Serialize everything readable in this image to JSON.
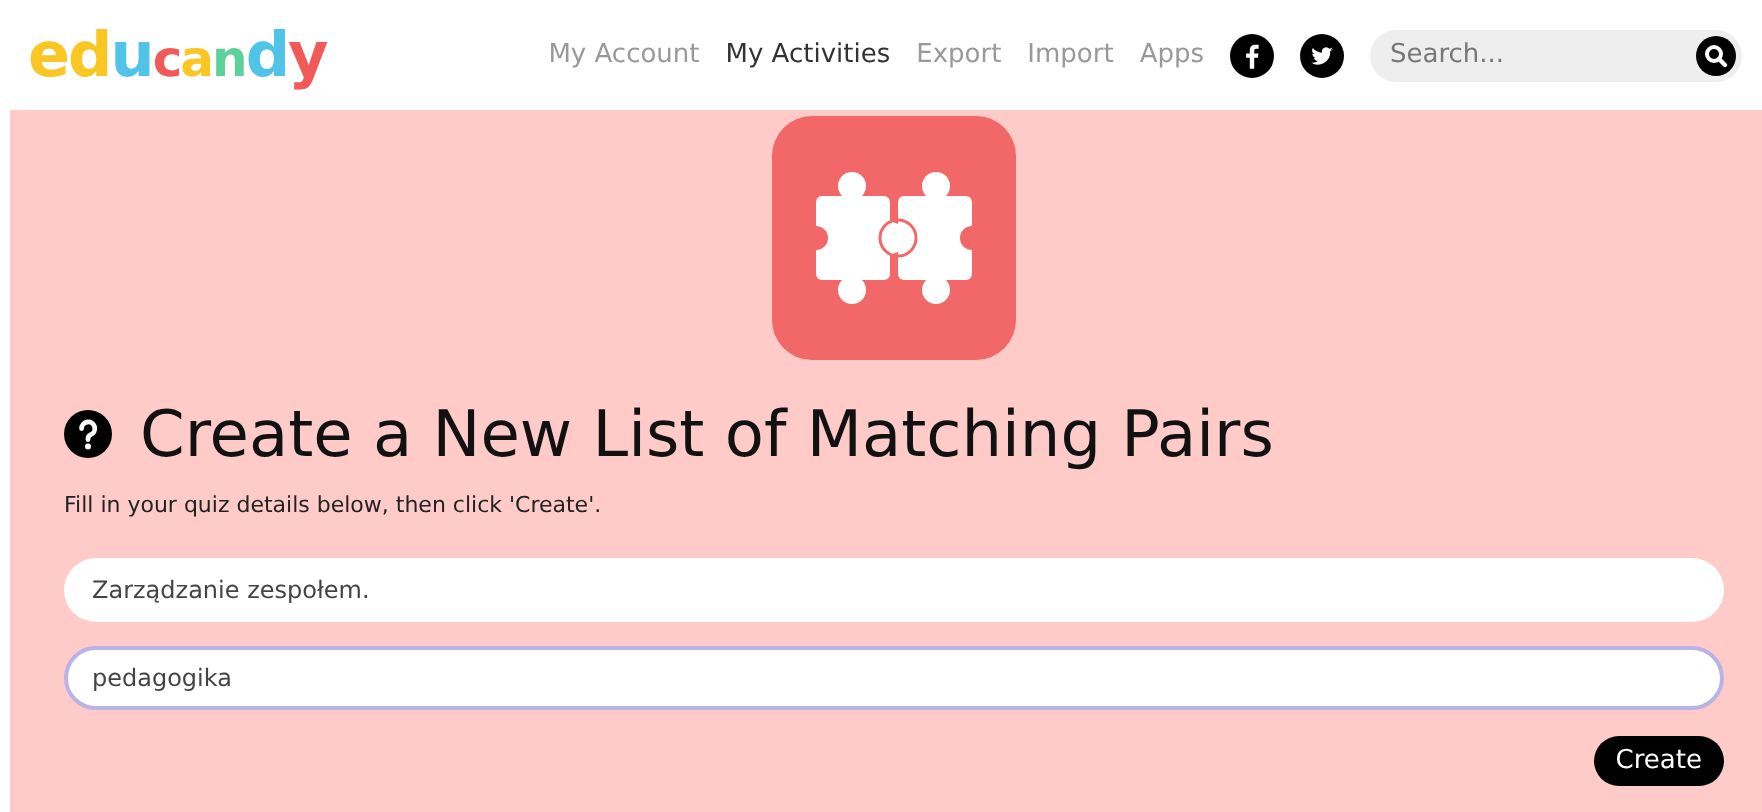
{
  "logo": {
    "text": "educandy"
  },
  "nav": [
    {
      "label": "My Account",
      "selected": false
    },
    {
      "label": "My Activities",
      "selected": true
    },
    {
      "label": "Export",
      "selected": false
    },
    {
      "label": "Import",
      "selected": false
    },
    {
      "label": "Apps",
      "selected": false
    }
  ],
  "search": {
    "placeholder": "Search..."
  },
  "heading": "Create a New List of Matching Pairs",
  "instructions": "Fill in your quiz details below, then click 'Create'.",
  "fields": [
    {
      "value": "Zarządzanie zespołem.",
      "focused": false
    },
    {
      "value": "pedagogika",
      "focused": true
    }
  ],
  "create_button": "Create"
}
